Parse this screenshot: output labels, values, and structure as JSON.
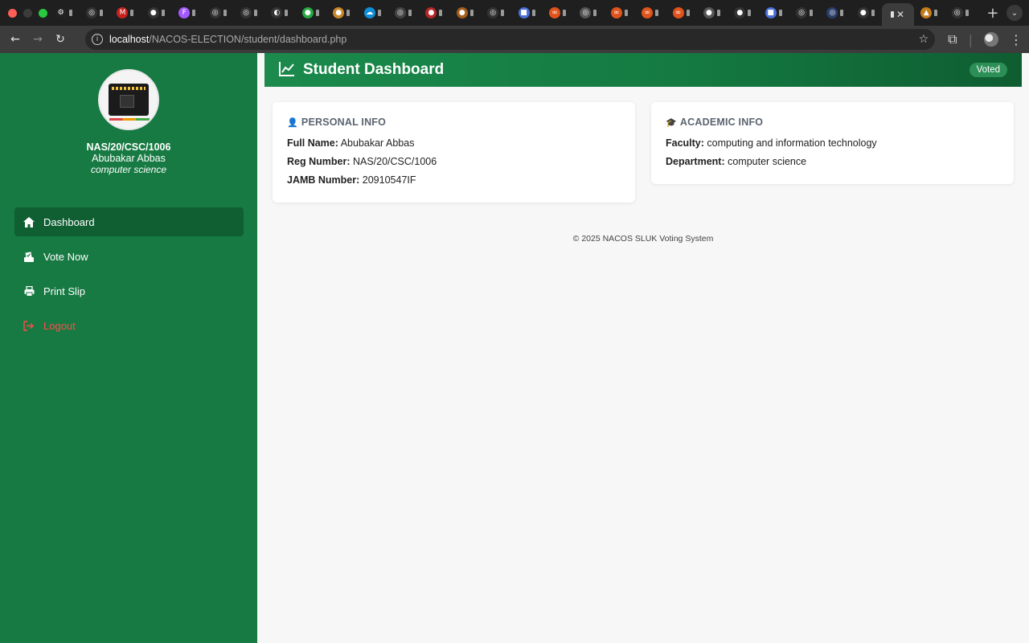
{
  "browser": {
    "url_host": "localhost",
    "url_path": "/NACOS-ELECTION/student/dashboard.php",
    "tabs": [
      {
        "icon": "openai-icon",
        "color": "#222",
        "glyph": "⚙"
      },
      {
        "icon": "chatgpt-icon",
        "color": "#333",
        "glyph": "◎"
      },
      {
        "icon": "gmail-icon",
        "color": "#c5221f",
        "glyph": "M"
      },
      {
        "icon": "github-icon",
        "color": "#333",
        "glyph": "●"
      },
      {
        "icon": "figma-icon",
        "color": "#a259ff",
        "glyph": "F"
      },
      {
        "icon": "chatgpt-icon",
        "color": "#333",
        "glyph": "◎"
      },
      {
        "icon": "openai-icon",
        "color": "#333",
        "glyph": "◎"
      },
      {
        "icon": "blender-icon",
        "color": "#333",
        "glyph": "◐"
      },
      {
        "icon": "app-icon",
        "color": "#27a844",
        "glyph": "●"
      },
      {
        "icon": "app-icon",
        "color": "#c8872a",
        "glyph": "●"
      },
      {
        "icon": "cloud-icon",
        "color": "#0f8ed8",
        "glyph": "☁"
      },
      {
        "icon": "app-icon",
        "color": "#444",
        "glyph": "◎"
      },
      {
        "icon": "app-icon",
        "color": "#b52626",
        "glyph": "●"
      },
      {
        "icon": "app-icon",
        "color": "#a35e1a",
        "glyph": "●"
      },
      {
        "icon": "chatgpt-icon",
        "color": "#333",
        "glyph": "◎"
      },
      {
        "icon": "doc-icon",
        "color": "#4a6fd8",
        "glyph": "■"
      },
      {
        "icon": "link-icon",
        "color": "#e0541c",
        "glyph": "∞"
      },
      {
        "icon": "globe-icon",
        "color": "#555",
        "glyph": "◎"
      },
      {
        "icon": "link-icon",
        "color": "#e0541c",
        "glyph": "∞"
      },
      {
        "icon": "link-icon",
        "color": "#e0541c",
        "glyph": "∞"
      },
      {
        "icon": "link-icon",
        "color": "#e0541c",
        "glyph": "∞"
      },
      {
        "icon": "app-icon",
        "color": "#555",
        "glyph": "●"
      },
      {
        "icon": "github-icon",
        "color": "#333",
        "glyph": "●"
      },
      {
        "icon": "doc-icon",
        "color": "#4a6fd8",
        "glyph": "■"
      },
      {
        "icon": "chatgpt-icon",
        "color": "#333",
        "glyph": "◎"
      },
      {
        "icon": "app-icon",
        "color": "#2a3d6b",
        "glyph": "◎"
      },
      {
        "icon": "github-icon",
        "color": "#333",
        "glyph": "●"
      },
      {
        "icon": "app-icon",
        "color": "#c57b1a",
        "glyph": "▲"
      },
      {
        "icon": "chatgpt-icon",
        "color": "#333",
        "glyph": "◎"
      }
    ]
  },
  "sidebar": {
    "reg_number": "NAS/20/CSC/1006",
    "name": "Abubakar Abbas",
    "department": "computer science",
    "items": [
      {
        "label": "Dashboard"
      },
      {
        "label": "Vote Now"
      },
      {
        "label": "Print Slip"
      },
      {
        "label": "Logout"
      }
    ]
  },
  "header": {
    "title": "Student Dashboard",
    "status_badge": "Voted"
  },
  "personal": {
    "heading": "PERSONAL INFO",
    "full_name_label": "Full Name:",
    "full_name": "Abubakar Abbas",
    "reg_label": "Reg Number:",
    "reg": "NAS/20/CSC/1006",
    "jamb_label": "JAMB Number:",
    "jamb": "20910547IF"
  },
  "academic": {
    "heading": "ACADEMIC INFO",
    "faculty_label": "Faculty:",
    "faculty": "computing and information technology",
    "department_label": "Department:",
    "department": "computer science"
  },
  "footer": {
    "text": "© 2025 NACOS SLUK Voting System"
  },
  "colors": {
    "sidebar": "#177a43",
    "active_item": "#0f5f33",
    "logout": "#ff4b4b",
    "header_start": "#1b8a4c",
    "header_end": "#0e5d31",
    "badge": "#2b8f56"
  }
}
